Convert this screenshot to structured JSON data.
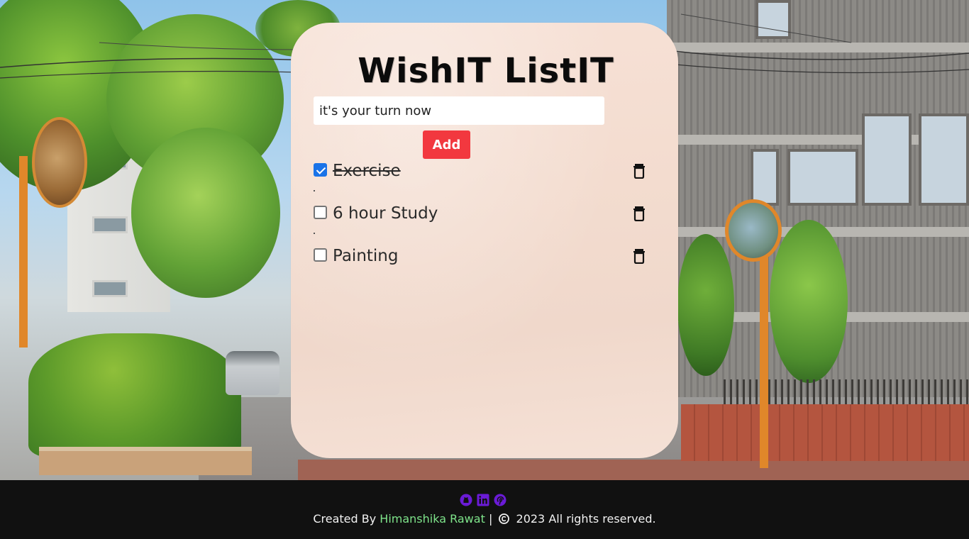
{
  "app": {
    "title": "WishIT ListIT"
  },
  "input": {
    "value": "it's your turn now",
    "placeholder": ""
  },
  "add_button": {
    "label": "Add",
    "color": "#f2383f"
  },
  "tasks": [
    {
      "label": "Exercise",
      "checked": true
    },
    {
      "label": "6 hour Study",
      "checked": false
    },
    {
      "label": "Painting",
      "checked": false
    }
  ],
  "task_icons": {
    "delete": "trash-icon"
  },
  "footer": {
    "prefix": "Created By",
    "author": "Himanshika Rawat",
    "separator": "|",
    "rights": "2023 All rights reserved.",
    "social_icons": [
      "github-icon",
      "linkedin-icon",
      "pinterest-icon"
    ],
    "social_color": "#6a1bd6",
    "author_color": "#7ee38a",
    "background": "#111111"
  }
}
